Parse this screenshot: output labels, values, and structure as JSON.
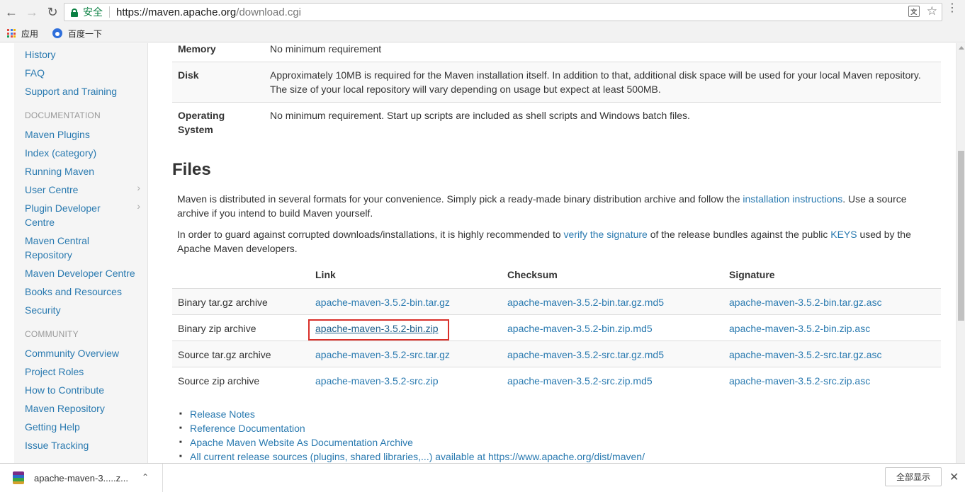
{
  "browser": {
    "secure_label": "安全",
    "url_host": "https://maven.apache.org",
    "url_path": "/download.cgi",
    "bookmarks": [
      "应用",
      "百度一下"
    ]
  },
  "sidebar": {
    "top_links": [
      "History",
      "FAQ",
      "Support and Training"
    ],
    "documentation_header": "DOCUMENTATION",
    "documentation_links": [
      "Maven Plugins",
      "Index (category)",
      "Running Maven",
      "User Centre",
      "Plugin Developer Centre",
      "Maven Central Repository",
      "Maven Developer Centre",
      "Books and Resources",
      "Security"
    ],
    "community_header": "COMMUNITY",
    "community_links": [
      "Community Overview",
      "Project Roles",
      "How to Contribute",
      "Maven Repository",
      "Getting Help",
      "Issue Tracking"
    ]
  },
  "requirements": [
    {
      "key": "Memory",
      "value": "No minimum requirement"
    },
    {
      "key": "Disk",
      "value": "Approximately 10MB is required for the Maven installation itself. In addition to that, additional disk space will be used for your local Maven repository. The size of your local repository will vary depending on usage but expect at least 500MB."
    },
    {
      "key": "Operating System",
      "value": "No minimum requirement. Start up scripts are included as shell scripts and Windows batch files."
    }
  ],
  "files": {
    "title": "Files",
    "para1_before": "Maven is distributed in several formats for your convenience. Simply pick a ready-made binary distribution archive and follow the ",
    "para1_link": "installation instructions",
    "para1_after": ". Use a source archive if you intend to build Maven yourself.",
    "para2_before": "In order to guard against corrupted downloads/installations, it is highly recommended to ",
    "para2_link1": "verify the signature",
    "para2_middle": " of the release bundles against the public ",
    "para2_link2": "KEYS",
    "para2_after": " used by the Apache Maven developers.",
    "headers": {
      "link": "Link",
      "checksum": "Checksum",
      "signature": "Signature"
    },
    "rows": [
      {
        "name": "Binary tar.gz archive",
        "link": "apache-maven-3.5.2-bin.tar.gz",
        "checksum": "apache-maven-3.5.2-bin.tar.gz.md5",
        "signature": "apache-maven-3.5.2-bin.tar.gz.asc"
      },
      {
        "name": "Binary zip archive",
        "link": "apache-maven-3.5.2-bin.zip",
        "checksum": "apache-maven-3.5.2-bin.zip.md5",
        "signature": "apache-maven-3.5.2-bin.zip.asc"
      },
      {
        "name": "Source tar.gz archive",
        "link": "apache-maven-3.5.2-src.tar.gz",
        "checksum": "apache-maven-3.5.2-src.tar.gz.md5",
        "signature": "apache-maven-3.5.2-src.tar.gz.asc"
      },
      {
        "name": "Source zip archive",
        "link": "apache-maven-3.5.2-src.zip",
        "checksum": "apache-maven-3.5.2-src.zip.md5",
        "signature": "apache-maven-3.5.2-src.zip.asc"
      }
    ],
    "bullets": [
      "Release Notes",
      "Reference Documentation",
      "Apache Maven Website As Documentation Archive",
      "All current release sources (plugins, shared libraries,...) available at https://www.apache.org/dist/maven/"
    ]
  },
  "download_shelf": {
    "file_name": "apache-maven-3.....z...",
    "show_all": "全部显示"
  },
  "colors": {
    "link": "#2a7ab0",
    "highlight_box": "#d9302a",
    "secure": "#0b8043"
  }
}
